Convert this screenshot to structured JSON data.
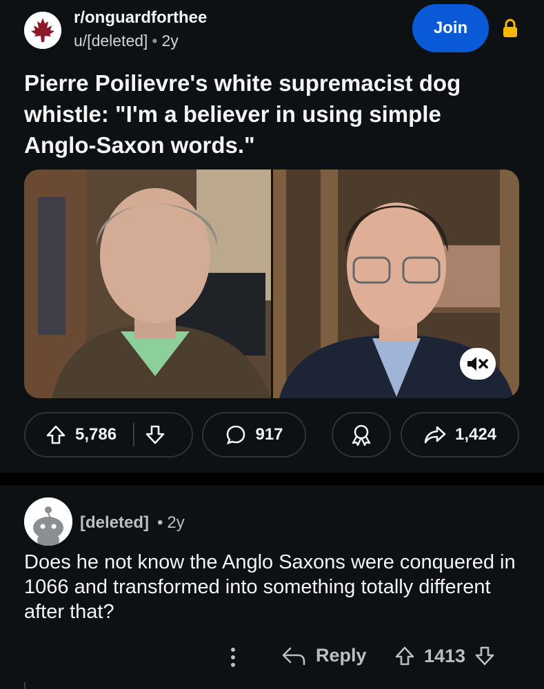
{
  "post": {
    "subreddit": "r/onguardforthee",
    "author": "u/[deleted]",
    "age": "2y",
    "join_label": "Join",
    "title": "Pierre Poilievre's white supremacist dog whistle: \"I'm a believer in using simple Anglo-Saxon words.\"",
    "upvotes": "5,786",
    "comments": "917",
    "shares": "1,424"
  },
  "comment": {
    "author": "[deleted]",
    "age": "2y",
    "body": "Does he not know the Anglo Saxons were conquered in 1066 and transformed into something totally different after that?",
    "reply_label": "Reply",
    "score": "1413"
  },
  "icons": {
    "subreddit_avatar": "maple-leaf-icon",
    "lock": "lock-icon",
    "mute": "speaker-muted-icon",
    "upvote": "upvote-arrow-icon",
    "downvote": "downvote-arrow-icon",
    "comment": "speech-bubble-icon",
    "award": "award-icon",
    "share": "share-arrow-icon",
    "reply": "reply-arrow-icon",
    "more": "more-vertical-icon"
  },
  "colors": {
    "background": "#0e1113",
    "join_button": "#0a5ad8",
    "lock": "#f5b800",
    "maple_leaf": "#8b1a2b"
  }
}
